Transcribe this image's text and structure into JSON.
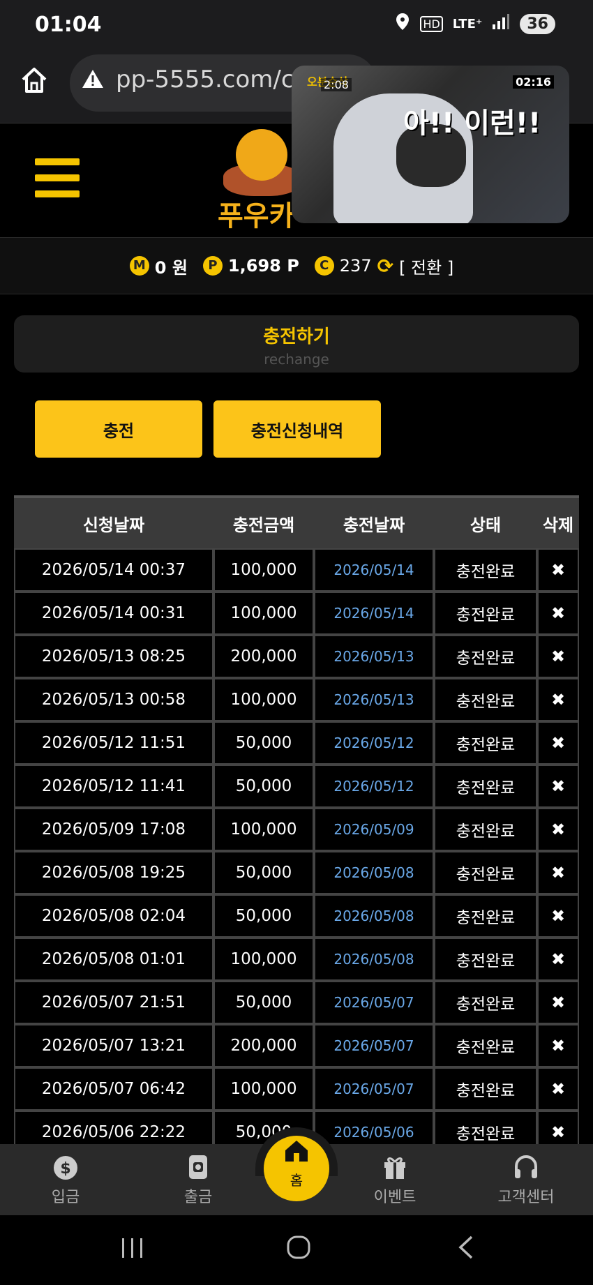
{
  "status_bar": {
    "time": "01:04",
    "icons": [
      "location-icon",
      "hd-icon",
      "lte-icon",
      "signal-icon"
    ],
    "hd": "HD",
    "lte": "LTE⁺",
    "battery": "36"
  },
  "browser": {
    "url": "pp-5555.com/cas"
  },
  "video": {
    "badge": "오분순삭",
    "time_left": "2:08",
    "time_right": "02:16",
    "caption": "아!! 이런!!"
  },
  "logo": {
    "text": "푸우카"
  },
  "balance": {
    "m_letter": "M",
    "m_value": "0 원",
    "p_letter": "P",
    "p_value": "1,698 P",
    "c_letter": "C",
    "c_value": "237",
    "convert": "[ 전환 ]"
  },
  "page": {
    "title": "충전하기",
    "subtitle": "rechange"
  },
  "buttons": {
    "charge": "충전",
    "history": "충전신청내역"
  },
  "table": {
    "headers": [
      "신청날짜",
      "충전금액",
      "충전날짜",
      "상태",
      "삭제"
    ],
    "rows": [
      {
        "req": "2026/05/14 00:37",
        "amount": "100,000",
        "date": "2026/05/14",
        "status": "충전완료",
        "del": "✖"
      },
      {
        "req": "2026/05/14 00:31",
        "amount": "100,000",
        "date": "2026/05/14",
        "status": "충전완료",
        "del": "✖"
      },
      {
        "req": "2026/05/13 08:25",
        "amount": "200,000",
        "date": "2026/05/13",
        "status": "충전완료",
        "del": "✖"
      },
      {
        "req": "2026/05/13 00:58",
        "amount": "100,000",
        "date": "2026/05/13",
        "status": "충전완료",
        "del": "✖"
      },
      {
        "req": "2026/05/12 11:51",
        "amount": "50,000",
        "date": "2026/05/12",
        "status": "충전완료",
        "del": "✖"
      },
      {
        "req": "2026/05/12 11:41",
        "amount": "50,000",
        "date": "2026/05/12",
        "status": "충전완료",
        "del": "✖"
      },
      {
        "req": "2026/05/09 17:08",
        "amount": "100,000",
        "date": "2026/05/09",
        "status": "충전완료",
        "del": "✖"
      },
      {
        "req": "2026/05/08 19:25",
        "amount": "50,000",
        "date": "2026/05/08",
        "status": "충전완료",
        "del": "✖"
      },
      {
        "req": "2026/05/08 02:04",
        "amount": "50,000",
        "date": "2026/05/08",
        "status": "충전완료",
        "del": "✖"
      },
      {
        "req": "2026/05/08 01:01",
        "amount": "100,000",
        "date": "2026/05/08",
        "status": "충전완료",
        "del": "✖"
      },
      {
        "req": "2026/05/07 21:51",
        "amount": "50,000",
        "date": "2026/05/07",
        "status": "충전완료",
        "del": "✖"
      },
      {
        "req": "2026/05/07 13:21",
        "amount": "200,000",
        "date": "2026/05/07",
        "status": "충전완료",
        "del": "✖"
      },
      {
        "req": "2026/05/07 06:42",
        "amount": "100,000",
        "date": "2026/05/07",
        "status": "충전완료",
        "del": "✖"
      },
      {
        "req": "2026/05/06 22:22",
        "amount": "50,000",
        "date": "2026/05/06",
        "status": "충전완료",
        "del": "✖"
      }
    ]
  },
  "bottom_nav": {
    "deposit": "입금",
    "withdraw": "출금",
    "home": "홈",
    "event": "이벤트",
    "support": "고객센터"
  },
  "colors": {
    "accent": "#f5c400",
    "date_link": "#6aa8e8",
    "background": "#000000"
  }
}
